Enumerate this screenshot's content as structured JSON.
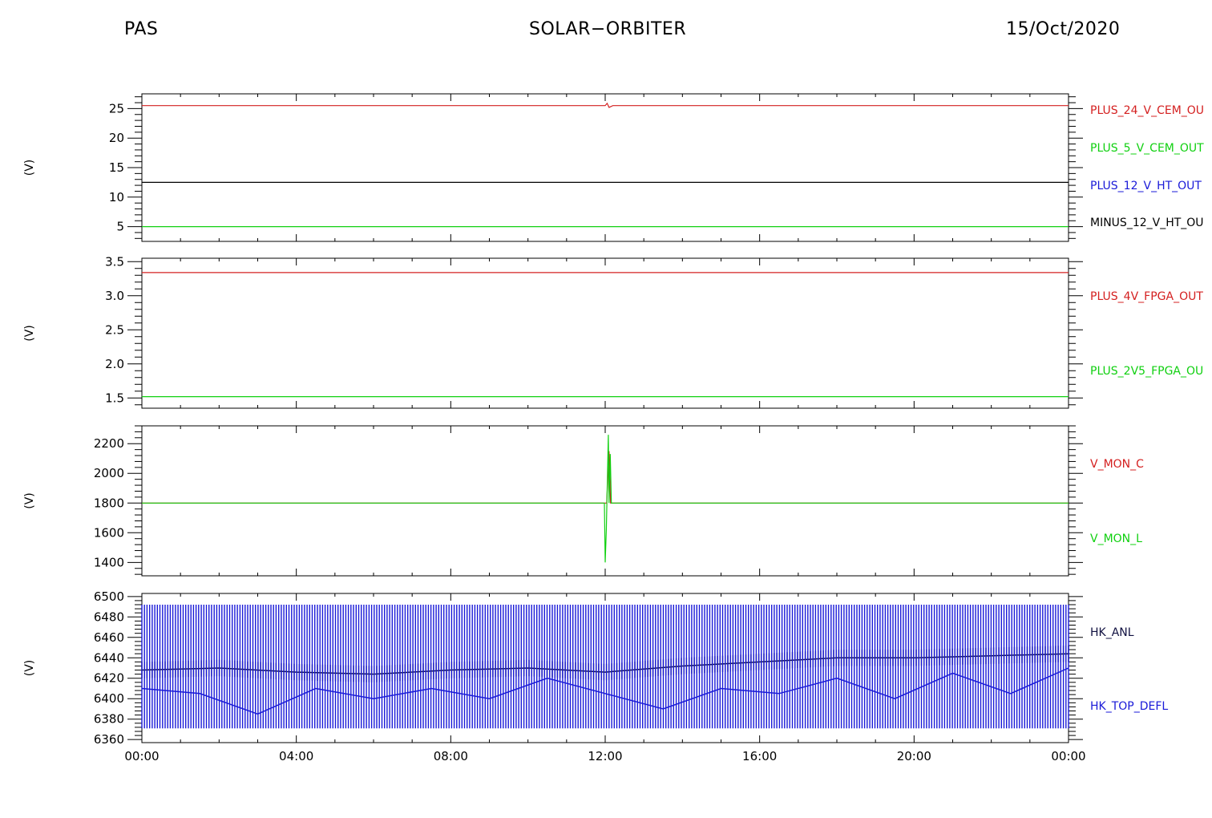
{
  "header": {
    "instrument": "PAS",
    "mission": "SOLAR−ORBITER",
    "date": "15/Oct/2020"
  },
  "colors": {
    "red": "#d42020",
    "green": "#10d010",
    "blue": "#1a1ad8",
    "navy": "#101040",
    "black": "#000000"
  },
  "chart_data": [
    {
      "type": "line",
      "ylabel": "(V)",
      "ylim": [
        2.5,
        27.5
      ],
      "yticks": [
        5,
        10,
        15,
        20,
        25
      ],
      "ytick_labels": [
        "5",
        "10",
        "15",
        "20",
        "25"
      ],
      "series": [
        {
          "name": "PLUS_24_V_CEM_OU",
          "color": "red",
          "level": 25.5,
          "x": [
            0,
            12.0,
            12.05,
            12.1,
            12.2,
            24
          ],
          "y": [
            25.5,
            25.5,
            25.9,
            25.2,
            25.5,
            25.5
          ]
        },
        {
          "name": "PLUS_5_V_CEM_OUT",
          "color": "green",
          "level": 5.0,
          "x": [
            0,
            24
          ],
          "y": [
            5.0,
            5.0
          ]
        },
        {
          "name": "PLUS_12_V_HT_OUT",
          "color": "blue",
          "level": null,
          "x": [],
          "y": []
        },
        {
          "name": "MINUS_12_V_HT_OU",
          "color": "black",
          "level": 12.5,
          "x": [
            0,
            24
          ],
          "y": [
            12.5,
            12.5
          ]
        }
      ]
    },
    {
      "type": "line",
      "ylabel": "(V)",
      "ylim": [
        1.35,
        3.55
      ],
      "yticks": [
        1.5,
        2.0,
        2.5,
        3.0,
        3.5
      ],
      "ytick_labels": [
        "1.5",
        "2.0",
        "2.5",
        "3.0",
        "3.5"
      ],
      "series": [
        {
          "name": "PLUS_4V_FPGA_OUT",
          "color": "red",
          "level": 3.34,
          "x": [
            0,
            24
          ],
          "y": [
            3.34,
            3.34
          ]
        },
        {
          "name": "PLUS_2V5_FPGA_OU",
          "color": "green",
          "level": 1.52,
          "x": [
            0,
            24
          ],
          "y": [
            1.52,
            1.52
          ]
        }
      ]
    },
    {
      "type": "line",
      "ylabel": "(V)",
      "ylim": [
        1310,
        2320
      ],
      "yticks": [
        1400,
        1600,
        1800,
        2000,
        2200
      ],
      "ytick_labels": [
        "1400",
        "1600",
        "1800",
        "2000",
        "2200"
      ],
      "series": [
        {
          "name": "V_MON_C",
          "color": "red",
          "level": 1800,
          "x": [
            0,
            12.0,
            12.04,
            12.1,
            12.14,
            24
          ],
          "y": [
            1800,
            1800,
            1800,
            2150,
            1800,
            1800
          ]
        },
        {
          "name": "V_MON_L",
          "color": "green",
          "level": 1800,
          "x": [
            0,
            11.98,
            12.0,
            12.03,
            12.08,
            12.1,
            12.13,
            12.16,
            24
          ],
          "y": [
            1800,
            1800,
            1400,
            1620,
            2260,
            1800,
            2130,
            1800,
            1800
          ]
        }
      ]
    },
    {
      "type": "line",
      "ylabel": "(V)",
      "ylim": [
        6357,
        6503
      ],
      "yticks": [
        6360,
        6380,
        6400,
        6420,
        6440,
        6460,
        6480,
        6500
      ],
      "ytick_labels": [
        "6360",
        "6380",
        "6400",
        "6420",
        "6440",
        "6460",
        "6480",
        "6500"
      ],
      "series": [
        {
          "name": "HK_ANL",
          "color": "navy",
          "band": [
            6418,
            6440
          ],
          "x": [
            0,
            2,
            4,
            6,
            8,
            10,
            12,
            14,
            16,
            18,
            20,
            22,
            24
          ],
          "y": [
            6428,
            6430,
            6426,
            6424,
            6428,
            6430,
            6426,
            6432,
            6436,
            6440,
            6440,
            6442,
            6444
          ]
        },
        {
          "name": "HK_TOP_DEFL",
          "color": "blue",
          "band": [
            6371,
            6492
          ],
          "x": [
            0,
            1.5,
            3,
            4.5,
            6,
            7.5,
            9,
            10.5,
            12,
            13.5,
            15,
            16.5,
            18,
            19.5,
            21,
            22.5,
            24
          ],
          "y": [
            6410,
            6405,
            6385,
            6410,
            6400,
            6410,
            6400,
            6420,
            6405,
            6390,
            6410,
            6405,
            6420,
            6400,
            6425,
            6405,
            6430
          ]
        }
      ]
    }
  ],
  "xaxis": {
    "range": [
      0,
      24
    ],
    "ticks": [
      0,
      4,
      8,
      12,
      16,
      20,
      24
    ],
    "tick_labels": [
      "00:00",
      "04:00",
      "08:00",
      "12:00",
      "16:00",
      "20:00",
      "00:00"
    ]
  }
}
